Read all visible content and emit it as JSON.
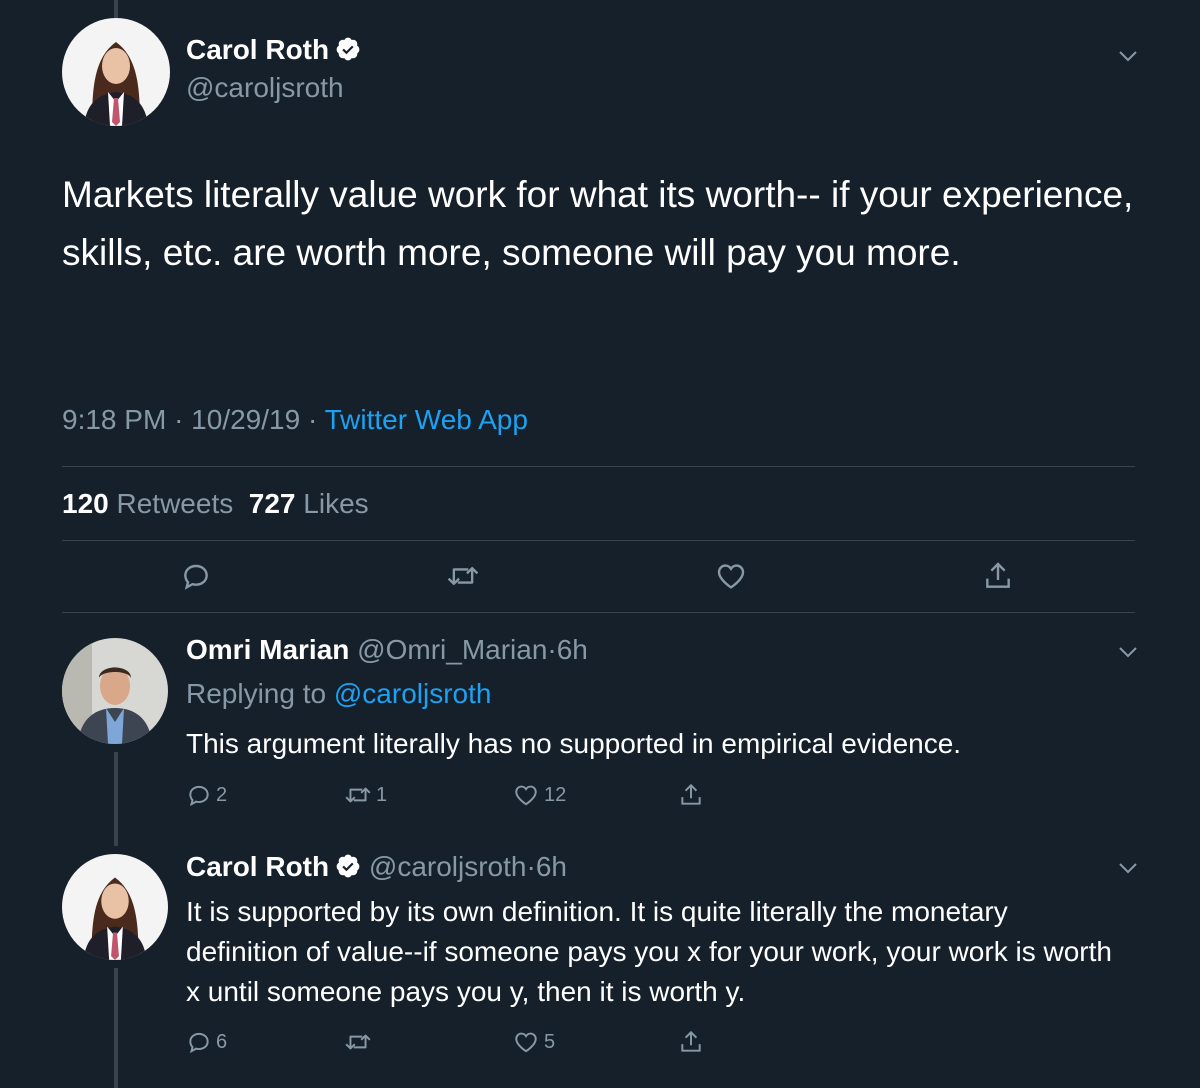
{
  "main_tweet": {
    "author_name": "Carol Roth",
    "author_handle": "@caroljsroth",
    "text": "Markets literally value work for what its worth-- if your experience, skills, etc. are worth more, someone will pay you more.",
    "time": "9:18 PM",
    "date": "10/29/19",
    "separator": "·",
    "source": "Twitter Web App",
    "retweets_count": "120",
    "retweets_label": "Retweets",
    "likes_count": "727",
    "likes_label": "Likes"
  },
  "replies": [
    {
      "author_name": "Omri Marian",
      "author_handle": "@Omri_Marian",
      "separator": "·",
      "age": "6h",
      "replying_label": "Replying to",
      "replying_to": "@caroljsroth",
      "text": "This argument literally has no supported in empirical evidence.",
      "reply_count": "2",
      "retweet_count": "1",
      "like_count": "12"
    },
    {
      "author_name": "Carol Roth",
      "author_handle": "@caroljsroth",
      "separator": "·",
      "age": "6h",
      "text": "It is supported by its own definition. It is quite literally the monetary definition of value--if someone pays you x for your work, your work is worth x until someone pays you y, then it is worth y.",
      "reply_count": "6",
      "retweet_count": "",
      "like_count": "5"
    }
  ],
  "icons": {
    "verified": "verified-badge-icon",
    "caret": "chevron-down-icon",
    "reply": "reply-icon",
    "retweet": "retweet-icon",
    "like": "heart-icon",
    "share": "share-icon"
  },
  "colors": {
    "background": "#15202b",
    "text": "#ffffff",
    "muted": "#8899a6",
    "accent": "#1da1f2",
    "divider": "#38444d"
  }
}
